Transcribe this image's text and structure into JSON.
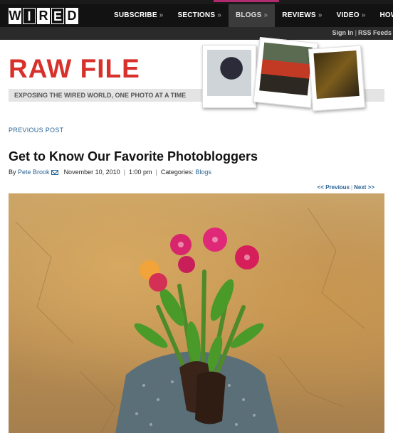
{
  "brand": {
    "logo_letters": [
      "W",
      "I",
      "R",
      "E",
      "D"
    ]
  },
  "nav": {
    "items": [
      {
        "label": "SUBSCRIBE",
        "chev": "»"
      },
      {
        "label": "SECTIONS",
        "chev": "»"
      },
      {
        "label": "BLOGS",
        "chev": "»",
        "active": true
      },
      {
        "label": "REVIEWS",
        "chev": "»"
      },
      {
        "label": "VIDEO",
        "chev": "»"
      },
      {
        "label": "HOW-T",
        "chev": ""
      }
    ]
  },
  "subnav": {
    "signin": "Sign In",
    "separator": "|",
    "rss": "RSS Feeds"
  },
  "blog": {
    "title": "RAW FILE",
    "tagline": "EXPOSING THE WIRED WORLD, ONE PHOTO AT A TIME"
  },
  "post": {
    "previous_post": "PREVIOUS POST",
    "title": "Get to Know Our Favorite Photobloggers",
    "by": "By",
    "author": "Pete Brook",
    "date": "November 10, 2010",
    "separator": "|",
    "time": "1:00 pm",
    "categories_label": "Categories:",
    "category": "Blogs",
    "pager_previous": "<< Previous",
    "pager_next": "Next >>"
  },
  "icons": {
    "email": "envelope-icon"
  },
  "colors": {
    "brand_red": "#d8312c",
    "link_blue": "#2a6496",
    "nav_bg": "#121212"
  }
}
